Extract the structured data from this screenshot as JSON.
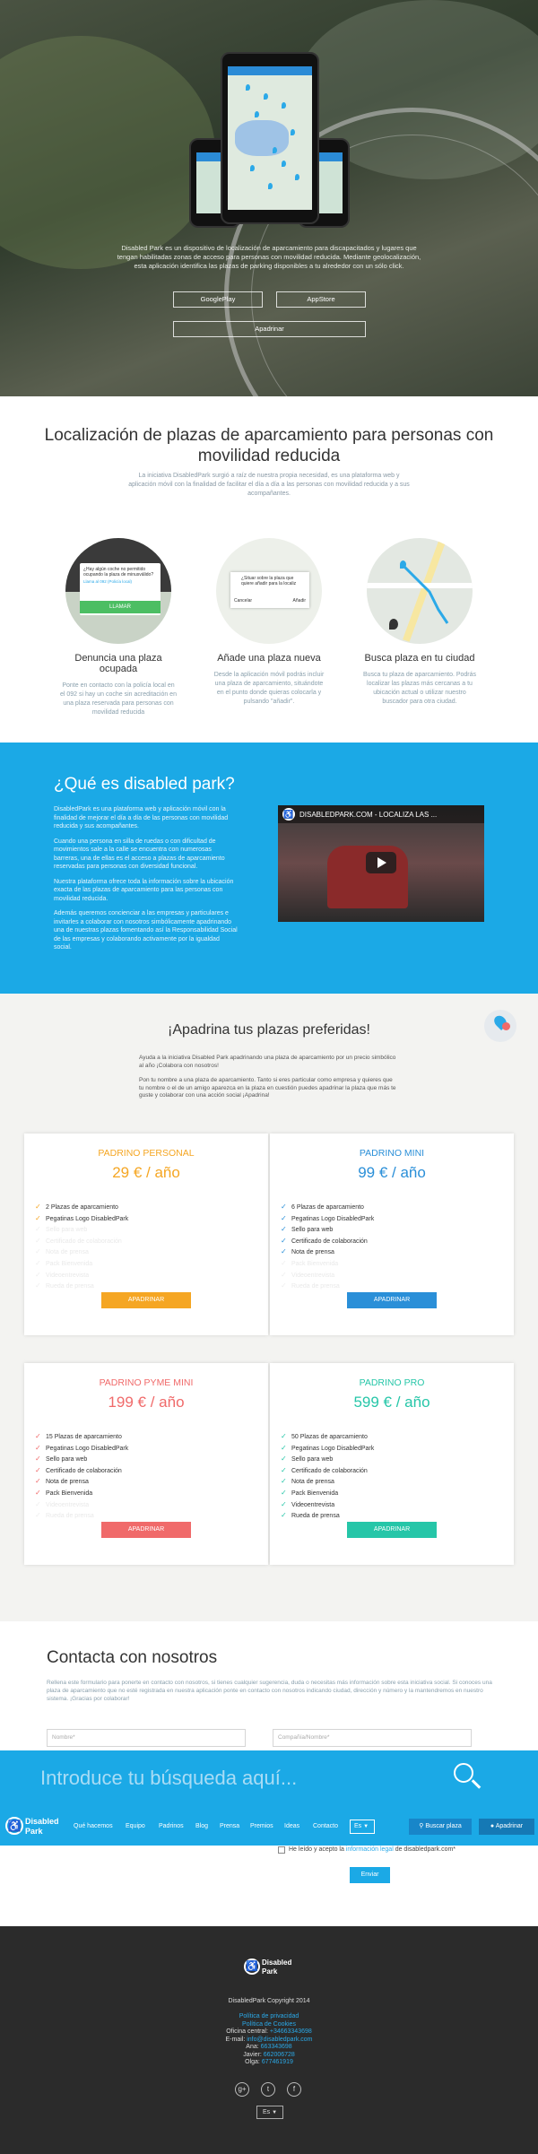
{
  "hero": {
    "description": "Disabled Park es un dispositivo de localización de aparcamiento para discapacitados y lugares que tengan habilitadas zonas de acceso para personas con movilidad reducida. Mediante geolocalización, esta aplicación identifica las plazas de parking disponibles a tu alrededor con un sólo click.",
    "btn_google": "GooglePlay",
    "btn_appstore": "AppStore",
    "btn_apadrinar": "Apadrinar"
  },
  "location": {
    "title": "Localización de plazas de aparcamiento para personas con movilidad reducida",
    "intro": "La iniciativa DisabledPark surgió a raíz de nuestra propia necesidad, es una plataforma web y aplicación móvil con la finalidad de facilitar el día a día a las personas con movilidad reducida y a sus acompañantes.",
    "features": [
      {
        "title": "Denuncia una plaza ocupada",
        "text": "Ponte en contacto con la policía local en el 092 si hay un coche sin acreditación en una plaza reservada para personas con movilidad reducida",
        "popup_text": "¿Hay algún coche no permitido ocupando la plaza de minusválido?",
        "popup_link": "Llama al 092 (Policía local)",
        "popup_btn": "LLAMAR"
      },
      {
        "title": "Añade una plaza nueva",
        "text": "Desde la aplicación móvil podrás incluir una plaza de aparcamiento, situándote en el punto donde quieras colocarla y pulsando \"añadir\".",
        "popup_text": "¿Situar sobre la plaza que quiere añadir para la localiz",
        "popup_cancel": "Cancelar",
        "popup_add": "Añadir"
      },
      {
        "title": "Busca plaza en tu ciudad",
        "text": "Busca tu plaza de aparcamiento. Podrás localizar las plazas más cercanas a tu ubicación actual o utilizar nuestro buscador para otra ciudad."
      }
    ]
  },
  "about": {
    "title": "¿Qué es disabled park?",
    "paragraphs": [
      "DisabledPark es una plataforma web y aplicación móvil con la finalidad de mejorar el día a día de las personas con movilidad reducida y sus acompañantes.",
      "Cuando una persona en silla de ruedas o con dificultad de movimientos sale a la calle se encuentra con numerosas barreras, una de ellas es el acceso a plazas de aparcamiento reservadas para personas con diversidad funcional.",
      "Nuestra plataforma ofrece toda la información sobre la ubicación exacta de las plazas de aparcamiento para las personas con movilidad reducida.",
      "Además queremos concienciar a las empresas y particulares e invitarles a colaborar con nosotros simbólicamente apadrinando una de nuestras plazas fomentando así la Responsabilidad Social de las empresas y colaborando activamente por la igualdad social."
    ],
    "video_title": "DISABLEDPARK.COM - LOCALIZA LAS ..."
  },
  "sponsor": {
    "title": "¡Apadrina tus plazas preferidas!",
    "intro1": "Ayuda a la iniciativa Disabled Park apadrinando una plaza de aparcamiento por un precio simbólico al año ¡Colabora con nosotros!",
    "intro2": "Pon tu nombre a una plaza de aparcamiento. Tanto si eres particular como empresa y quieres que tu nombre o el de un amigo aparezca en la plaza en cuestión puedes apadrinar la plaza que más te guste y colaborar con una acción social ¡Apadrina!",
    "plans": [
      {
        "name": "PADRINO PERSONAL",
        "price": "29 € / año",
        "color": "#f5a623",
        "button": "APADRINAR",
        "items": [
          {
            "t": "2 Plazas de aparcamiento",
            "on": true
          },
          {
            "t": "Pegatinas Logo DisabledPark",
            "on": true
          },
          {
            "t": "Sello para web",
            "on": false
          },
          {
            "t": "Certificado de colaboración",
            "on": false
          },
          {
            "t": "Nota de prensa",
            "on": false
          },
          {
            "t": "Pack Bienvenida",
            "on": false
          },
          {
            "t": "Videoentrevista",
            "on": false
          },
          {
            "t": "Rueda de prensa",
            "on": false
          }
        ]
      },
      {
        "name": "PADRINO MINI",
        "price": "99 € / año",
        "color": "#2a8fd8",
        "button": "APADRINAR",
        "items": [
          {
            "t": "6 Plazas de aparcamiento",
            "on": true
          },
          {
            "t": "Pegatinas Logo DisabledPark",
            "on": true
          },
          {
            "t": "Sello para web",
            "on": true
          },
          {
            "t": "Certificado de colaboración",
            "on": true
          },
          {
            "t": "Nota de prensa",
            "on": true
          },
          {
            "t": "Pack Bienvenida",
            "on": false
          },
          {
            "t": "Videoentrevista",
            "on": false
          },
          {
            "t": "Rueda de prensa",
            "on": false
          }
        ]
      },
      {
        "name": "PADRINO PYME MINI",
        "price": "199 € / año",
        "color": "#f06a6a",
        "button": "APADRINAR",
        "items": [
          {
            "t": "15 Plazas de aparcamiento",
            "on": true
          },
          {
            "t": "Pegatinas Logo DisabledPark",
            "on": true
          },
          {
            "t": "Sello para web",
            "on": true
          },
          {
            "t": "Certificado de colaboración",
            "on": true
          },
          {
            "t": "Nota de prensa",
            "on": true
          },
          {
            "t": "Pack Bienvenida",
            "on": true
          },
          {
            "t": "Videoentrevista",
            "on": false
          },
          {
            "t": "Rueda de prensa",
            "on": false
          }
        ]
      },
      {
        "name": "PADRINO PRO",
        "price": "599 € / año",
        "color": "#26c6a8",
        "button": "APADRINAR",
        "items": [
          {
            "t": "50 Plazas de aparcamiento",
            "on": true
          },
          {
            "t": "Pegatinas Logo DisabledPark",
            "on": true
          },
          {
            "t": "Sello para web",
            "on": true
          },
          {
            "t": "Certificado de colaboración",
            "on": true
          },
          {
            "t": "Nota de prensa",
            "on": true
          },
          {
            "t": "Pack Bienvenida",
            "on": true
          },
          {
            "t": "Videoentrevista",
            "on": true
          },
          {
            "t": "Rueda de prensa",
            "on": true
          }
        ]
      }
    ]
  },
  "contact": {
    "title": "Contacta con nosotros",
    "text": "Rellena este formulario para ponerte en contacto con nosotros, si tienes cualquier sugerencia, duda o necesitas más información sobre esta iniciativa social. Si conoces una plaza de aparcamiento que no esté registrada en nuestra aplicación ponte en contacto con nosotros indicando ciudad, dirección y número y la mantendremos en nuestro sistema. ¡Gracias por colaborar!",
    "name_placeholder": "Nombre*",
    "company_placeholder": "Compañía/Nombre*",
    "privacy_prefix": "He leído y acepto la",
    "privacy_link": "información legal",
    "privacy_suffix": "de disabledpark.com*",
    "send": "Enviar"
  },
  "search": {
    "placeholder": "Introduce tu búsqueda aquí..."
  },
  "nav": {
    "logo_line1": "Disabled",
    "logo_line2": "Park",
    "links": [
      "Qué hacemos",
      "Equipo",
      "Padrinos",
      "Blog",
      "Prensa",
      "Premios",
      "Ideas",
      "Contacto"
    ],
    "lang": "Es",
    "search_btn": "Buscar plaza",
    "apadrinar_btn": "Apadrinar"
  },
  "footer": {
    "logo_line1": "Disabled",
    "logo_line2": "Park",
    "copyright": "DisabledPark Copyright 2014",
    "privacy": "Política de privacidad",
    "cookies": "Política de Cookies",
    "office_label": "Oficina central:",
    "office_phone": "+34663343698",
    "email_label": "E-mail:",
    "email": "info@disabledpark.com",
    "people": [
      {
        "name": "Ana:",
        "phone": "663343698"
      },
      {
        "name": "Javier:",
        "phone": "662006728"
      },
      {
        "name": "Olga:",
        "phone": "677461919"
      }
    ],
    "lang": "Es"
  },
  "colors": {
    "primary": "#1ba9e6",
    "dark": "#2b2b2b"
  }
}
